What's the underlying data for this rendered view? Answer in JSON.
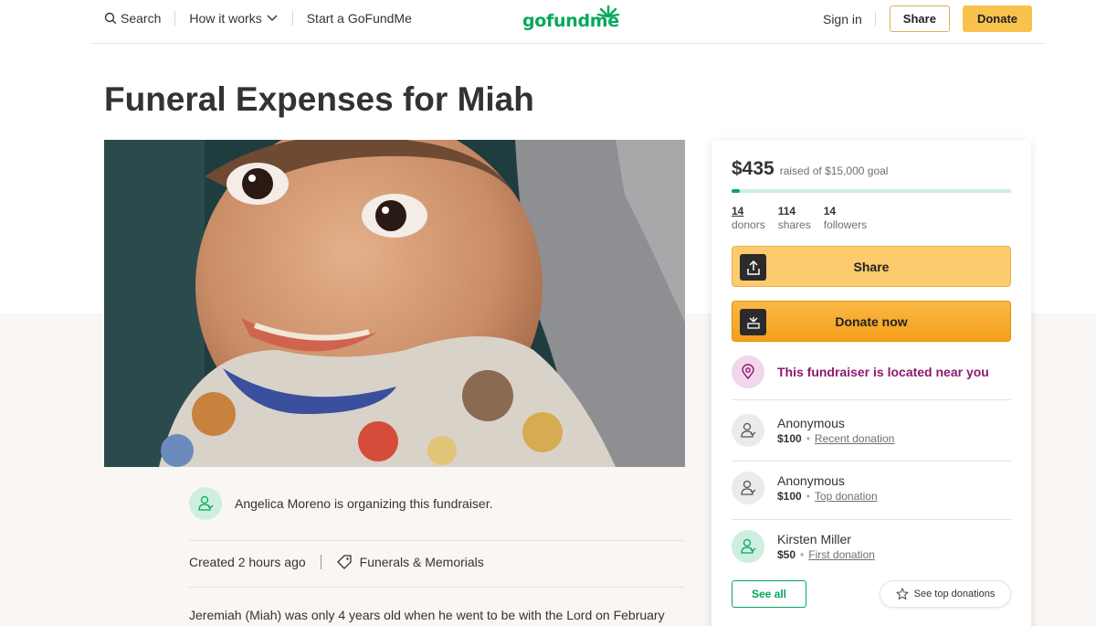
{
  "header": {
    "search_label": "Search",
    "how_it_works_label": "How it works",
    "start_label": "Start a GoFundMe",
    "logo_text": "gofundme",
    "signin_label": "Sign in",
    "share_label": "Share",
    "donate_label": "Donate"
  },
  "page": {
    "title": "Funeral Expenses for Miah"
  },
  "organizer": {
    "text": "Angelica Moreno is organizing this fundraiser."
  },
  "meta": {
    "created": "Created 2 hours ago",
    "category": "Funerals & Memorials"
  },
  "story": {
    "first_line": "Jeremiah (Miah) was only 4 years old when he went to be with the Lord on February"
  },
  "sidebar": {
    "raised_amount": "$435",
    "raised_goal_text": "raised of $15,000 goal",
    "progress_fraction": 0.029,
    "stats": [
      {
        "value": "14",
        "label": "donors"
      },
      {
        "value": "114",
        "label": "shares"
      },
      {
        "value": "14",
        "label": "followers"
      }
    ],
    "share_button": "Share",
    "donate_button": "Donate now",
    "location_text": "This fundraiser is located near you",
    "donations": [
      {
        "name": "Anonymous",
        "amount": "$100",
        "tag": "Recent donation"
      },
      {
        "name": "Anonymous",
        "amount": "$100",
        "tag": "Top donation"
      },
      {
        "name": "Kirsten Miller",
        "amount": "$50",
        "tag": "First donation"
      }
    ],
    "see_all_label": "See all",
    "see_top_label": "See top donations"
  },
  "colors": {
    "brand_green": "#02a95c",
    "donate_yellow": "#f9c24d",
    "location_purple": "#8c1a6e"
  },
  "icons": [
    "search-icon",
    "chevron-down-icon",
    "gofundme-sprout-icon",
    "upload-share-icon",
    "gofundme-badge-icon",
    "location-pin-icon",
    "user-heart-icon",
    "tag-icon",
    "star-icon"
  ]
}
